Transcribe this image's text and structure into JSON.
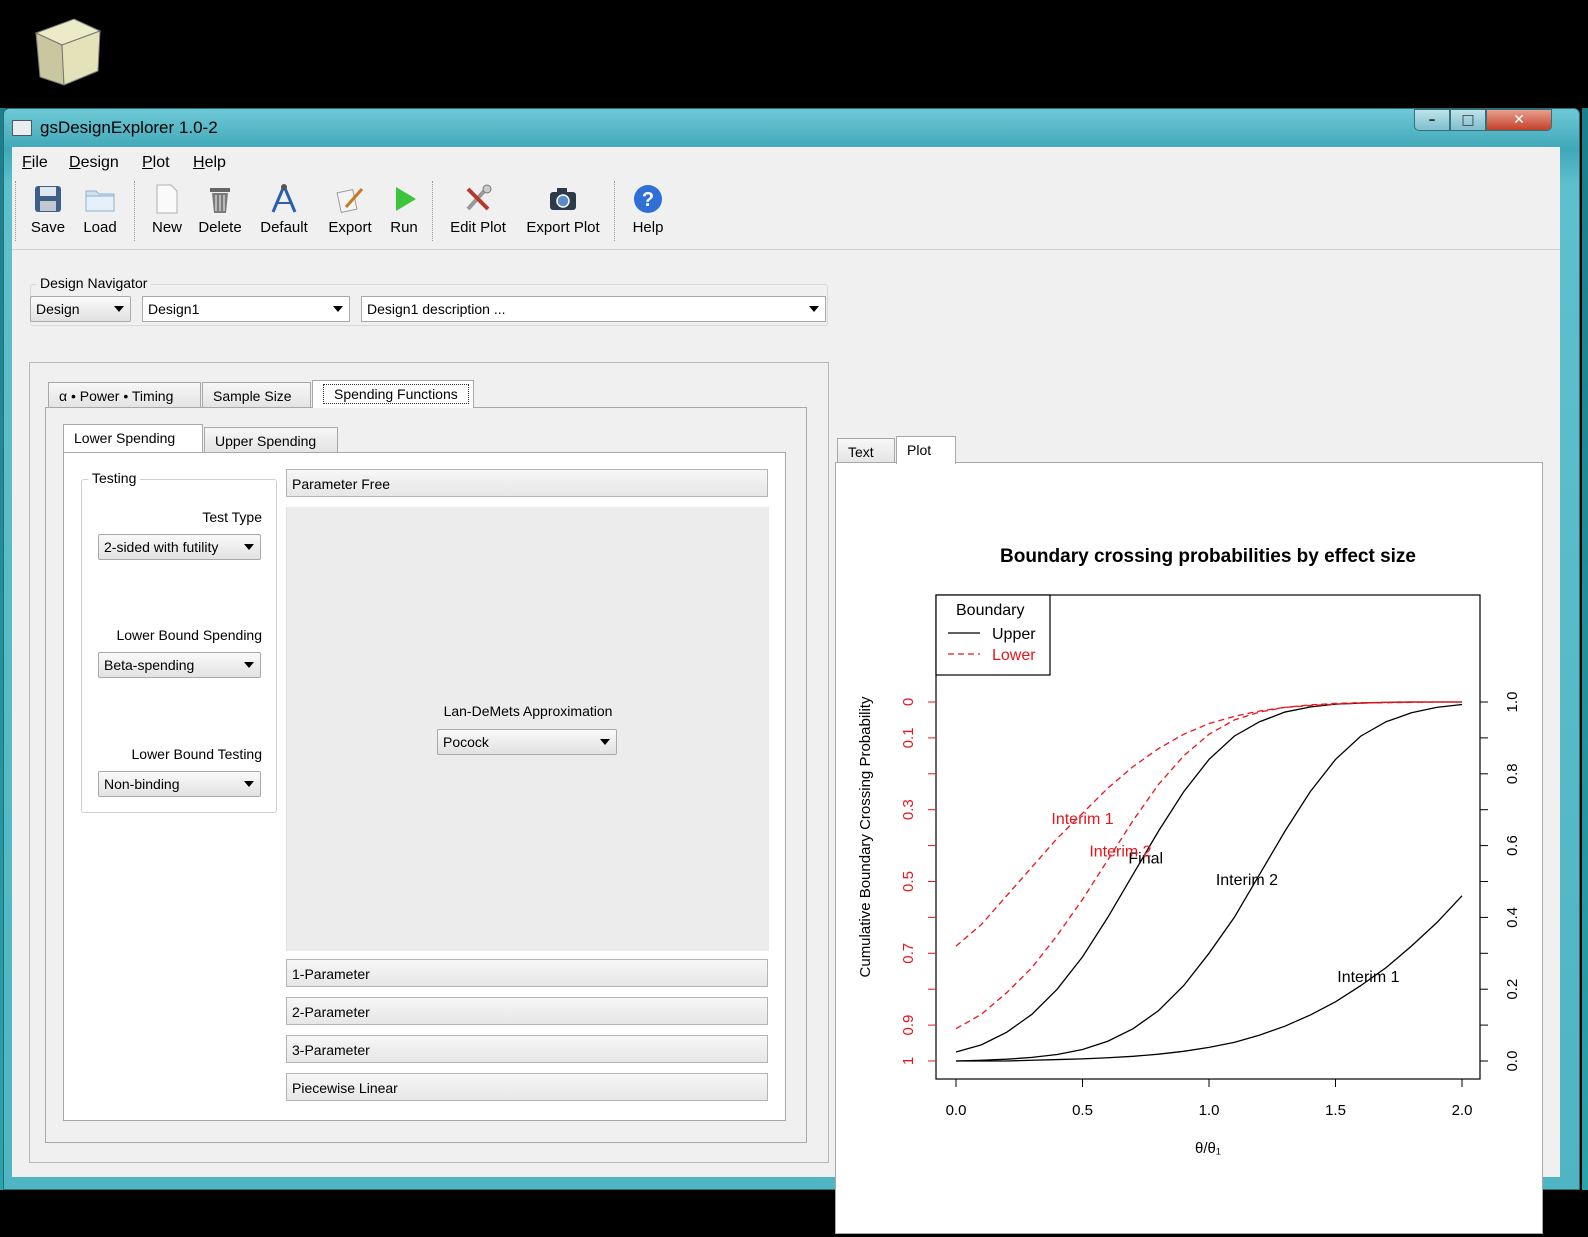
{
  "window": {
    "title": "gsDesignExplorer 1.0-2",
    "controls": [
      "–",
      "□",
      "✕"
    ]
  },
  "menu": [
    "File",
    "Design",
    "Plot",
    "Help"
  ],
  "toolbar": {
    "groups": [
      [
        {
          "label": "Save",
          "icon": "save-icon"
        },
        {
          "label": "Load",
          "icon": "folder-icon"
        }
      ],
      [
        {
          "label": "New",
          "icon": "new-document-icon"
        },
        {
          "label": "Delete",
          "icon": "trash-icon"
        },
        {
          "label": "Default",
          "icon": "compass-icon"
        },
        {
          "label": "Export",
          "icon": "export-icon"
        },
        {
          "label": "Run",
          "icon": "run-icon"
        }
      ],
      [
        {
          "label": "Edit Plot",
          "icon": "tools-icon"
        },
        {
          "label": "Export Plot",
          "icon": "camera-icon"
        }
      ],
      [
        {
          "label": "Help",
          "icon": "help-icon"
        }
      ]
    ]
  },
  "navigator": {
    "title": "Design Navigator",
    "type": "Design",
    "design": "Design1",
    "description": "Design1 description ..."
  },
  "left_tabs": [
    "α • Power • Timing",
    "Sample Size",
    "Spending Functions"
  ],
  "left_active_tab": 2,
  "spending_tabs": [
    "Lower Spending",
    "Upper Spending"
  ],
  "spending_active_tab": 0,
  "testing": {
    "title": "Testing",
    "test_type_label": "Test Type",
    "test_type": "2-sided with futility",
    "lower_bound_spending_label": "Lower Bound Spending",
    "lower_bound_spending": "Beta-spending",
    "lower_bound_testing_label": "Lower Bound Testing",
    "lower_bound_testing": "Non-binding"
  },
  "sections": {
    "open": "Parameter Free",
    "lan_demets_label": "Lan-DeMets Approximation",
    "lan_demets_value": "Pocock",
    "closed": [
      "1-Parameter",
      "2-Parameter",
      "3-Parameter",
      "Piecewise Linear"
    ]
  },
  "right_tabs": [
    "Text",
    "Plot"
  ],
  "right_active_tab": 1,
  "chart_data": {
    "type": "line",
    "title": "Boundary crossing probabilities by effect size",
    "xlabel": "θ/θ₁",
    "ylabel": "Cumulative Boundary Crossing Probability",
    "xlim": [
      0,
      2
    ],
    "x_ticks": [
      0.0,
      0.5,
      1.0,
      1.5,
      2.0
    ],
    "x_tick_labels": [
      "0.0",
      "0.5",
      "1.0",
      "1.5",
      "2.0"
    ],
    "right_axis": {
      "ylim": [
        0,
        1
      ],
      "ticks": [
        0.0,
        0.2,
        0.4,
        0.6,
        0.8,
        1.0
      ],
      "tick_labels": [
        "0.0",
        "0.2",
        "0.4",
        "0.6",
        "0.8",
        "1.0"
      ]
    },
    "left_axis": {
      "reversed": true,
      "ticks": [
        0,
        0.1,
        0.2,
        0.3,
        0.4,
        0.5,
        0.6,
        0.7,
        0.8,
        0.9,
        1
      ],
      "tick_labels": [
        "0",
        "0.1",
        "",
        "0.3",
        "",
        "0.5",
        "",
        "0.7",
        "",
        "0.9",
        "1"
      ],
      "color": "#e8141c"
    },
    "legend": {
      "title": "Boundary",
      "position": "top-left",
      "entries": [
        {
          "name": "Upper",
          "color": "#000000",
          "dash": "solid"
        },
        {
          "name": "Lower",
          "color": "#e8141c",
          "dash": "dashed"
        }
      ]
    },
    "x": [
      0,
      0.1,
      0.2,
      0.3,
      0.4,
      0.5,
      0.6,
      0.7,
      0.8,
      0.9,
      1.0,
      1.1,
      1.2,
      1.3,
      1.4,
      1.5,
      1.6,
      1.7,
      1.8,
      1.9,
      2.0
    ],
    "series": [
      {
        "name": "Upper",
        "label": "Interim 1",
        "color": "#000000",
        "dash": "solid",
        "label_at": [
          1.63,
          0.22
        ],
        "values": [
          0.0,
          0.0,
          0.0,
          0.002,
          0.004,
          0.006,
          0.009,
          0.013,
          0.019,
          0.027,
          0.038,
          0.052,
          0.072,
          0.097,
          0.128,
          0.165,
          0.21,
          0.26,
          0.32,
          0.385,
          0.46
        ]
      },
      {
        "name": "Upper",
        "label": "Interim 2",
        "color": "#000000",
        "dash": "solid",
        "label_at": [
          1.15,
          0.49
        ],
        "values": [
          0.0,
          0.002,
          0.005,
          0.01,
          0.018,
          0.032,
          0.055,
          0.09,
          0.14,
          0.21,
          0.3,
          0.4,
          0.52,
          0.64,
          0.75,
          0.84,
          0.905,
          0.945,
          0.97,
          0.985,
          0.993
        ]
      },
      {
        "name": "Upper",
        "label": "Final",
        "color": "#000000",
        "dash": "solid",
        "label_at": [
          0.75,
          0.55
        ],
        "values": [
          0.025,
          0.045,
          0.08,
          0.13,
          0.2,
          0.29,
          0.4,
          0.52,
          0.64,
          0.75,
          0.84,
          0.905,
          0.945,
          0.972,
          0.986,
          0.994,
          0.997,
          0.999,
          1.0,
          1.0,
          1.0
        ]
      },
      {
        "name": "Lower",
        "label": "Interim 1",
        "color": "#e8141c",
        "dash": "dashed",
        "label_at": [
          0.5,
          0.66
        ],
        "values": [
          0.32,
          0.38,
          0.46,
          0.54,
          0.62,
          0.69,
          0.76,
          0.82,
          0.87,
          0.91,
          0.94,
          0.96,
          0.975,
          0.985,
          0.99,
          0.994,
          0.997,
          0.998,
          0.999,
          1.0,
          1.0
        ]
      },
      {
        "name": "Lower",
        "label": "Interim 2",
        "color": "#e8141c",
        "dash": "dashed",
        "label_at": [
          0.65,
          0.57
        ],
        "values": [
          0.09,
          0.13,
          0.19,
          0.26,
          0.35,
          0.45,
          0.56,
          0.67,
          0.77,
          0.85,
          0.91,
          0.95,
          0.972,
          0.985,
          0.992,
          0.996,
          0.998,
          0.999,
          1.0,
          1.0,
          1.0
        ]
      }
    ]
  }
}
